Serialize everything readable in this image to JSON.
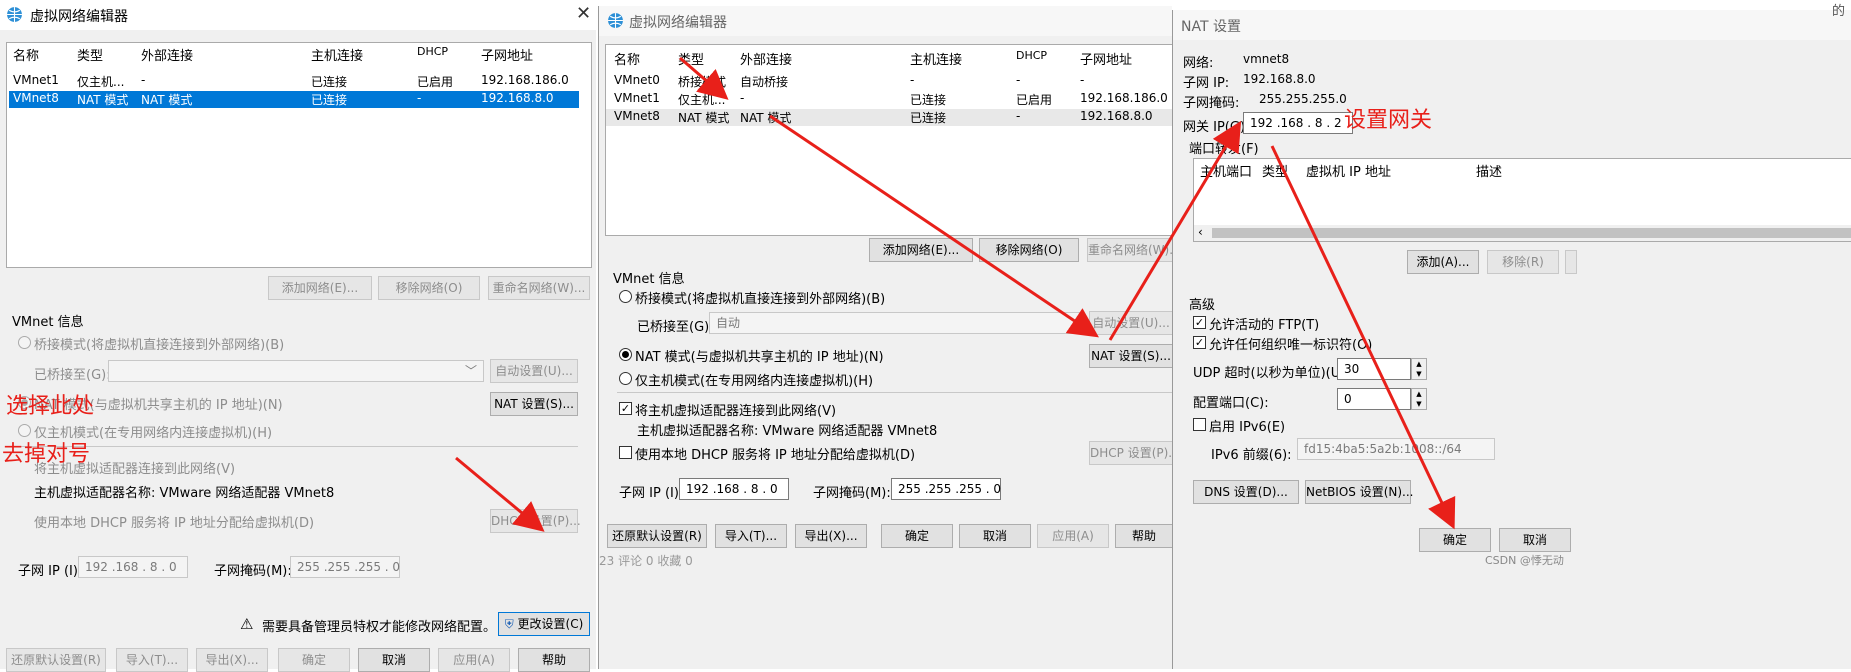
{
  "left_dialog": {
    "title": "虚拟网络编辑器",
    "columns": [
      "名称",
      "类型",
      "外部连接",
      "主机连接",
      "DHCP",
      "子网地址"
    ],
    "rows": [
      [
        "VMnet1",
        "仅主机...",
        "-",
        "已连接",
        "已启用",
        "192.168.186.0"
      ],
      [
        "VMnet8",
        "NAT 模式",
        "NAT 模式",
        "已连接",
        "-",
        "192.168.8.0"
      ]
    ],
    "buttons": {
      "add": "添加网络(E)...",
      "remove": "移除网络(O)",
      "rename": "重命名网络(W)..."
    },
    "vmnet_info": "VMnet 信息",
    "bridge_mode": "桥接模式(将虚拟机直接连接到外部网络)(B)",
    "bridged_to": "已桥接至(G):",
    "auto_settings": "自动设置(U)...",
    "nat_mode": "NAT 模式(与虚拟机共享主机的 IP 地址)(N)",
    "nat_settings": "NAT 设置(S)...",
    "host_only": "仅主机模式(在专用网络内连接虚拟机)(H)",
    "connect_adapter": "将主机虚拟适配器连接到此网络(V)",
    "adapter_name": "主机虚拟适配器名称: VMware 网络适配器 VMnet8",
    "use_dhcp": "使用本地 DHCP 服务将 IP 地址分配给虚拟机(D)",
    "dhcp_settings": "DHCP 设置(P)...",
    "subnet_ip_label": "子网 IP (I):",
    "subnet_ip": "192 .168 . 8  . 0",
    "mask_label": "子网掩码(M):",
    "mask": "255 .255 .255 . 0",
    "warn": "需要具备管理员特权才能修改网络配置。",
    "change_settings": "更改设置(C)",
    "bottom": {
      "restore": "还原默认设置(R)",
      "import": "导入(T)...",
      "export": "导出(X)...",
      "ok": "确定",
      "cancel": "取消",
      "apply": "应用(A)",
      "help": "帮助"
    }
  },
  "mid_dialog": {
    "title": "虚拟网络编辑器",
    "columns": [
      "名称",
      "类型",
      "外部连接",
      "主机连接",
      "DHCP",
      "子网地址"
    ],
    "rows": [
      [
        "VMnet0",
        "桥接模式",
        "自动桥接",
        "-",
        "-",
        "-"
      ],
      [
        "VMnet1",
        "仅主机...",
        "-",
        "已连接",
        "已启用",
        "192.168.186.0"
      ],
      [
        "VMnet8",
        "NAT 模式",
        "NAT 模式",
        "已连接",
        "-",
        "192.168.8.0"
      ]
    ],
    "buttons": {
      "add": "添加网络(E)...",
      "remove": "移除网络(O)",
      "rename": "重命名网络(W)..."
    },
    "vmnet_info": "VMnet 信息",
    "bridge_mode": "桥接模式(将虚拟机直接连接到外部网络)(B)",
    "bridged_to": "已桥接至(G):",
    "bridged_value": "自动",
    "auto_settings": "自动设置(U)...",
    "nat_mode": "NAT 模式(与虚拟机共享主机的 IP 地址)(N)",
    "nat_settings": "NAT 设置(S)...",
    "host_only": "仅主机模式(在专用网络内连接虚拟机)(H)",
    "connect_adapter": "将主机虚拟适配器连接到此网络(V)",
    "adapter_name": "主机虚拟适配器名称: VMware 网络适配器 VMnet8",
    "use_dhcp": "使用本地 DHCP 服务将 IP 地址分配给虚拟机(D)",
    "dhcp_settings": "DHCP 设置(P)...",
    "subnet_ip_label": "子网 IP (I):",
    "subnet_ip": "192 .168 . 8  . 0",
    "mask_label": "子网掩码(M):",
    "mask": "255 .255 .255 . 0",
    "bottom": {
      "restore": "还原默认设置(R)",
      "import": "导入(T)...",
      "export": "导出(X)...",
      "ok": "确定",
      "cancel": "取消",
      "apply": "应用(A)",
      "help": "帮助"
    }
  },
  "nat_dialog": {
    "title": "NAT 设置",
    "network_label": "网络:",
    "network": "vmnet8",
    "subnet_ip_label": "子网 IP:",
    "subnet_ip": "192.168.8.0",
    "mask_label": "子网掩码:",
    "mask": "255.255.255.0",
    "gateway_label": "网关 IP(G):",
    "gateway": "192 .168 . 8  . 2",
    "port_forward": "端口转发(F)",
    "pf_columns": [
      "主机端口",
      "类型",
      "虚拟机 IP 地址",
      "描述"
    ],
    "add": "添加(A)...",
    "remove": "移除(R)",
    "advanced": "高级",
    "allow_ftp": "允许活动的 FTP(T)",
    "allow_uid": "允许任何组织唯一标识符(O)",
    "udp_label": "UDP 超时(以秒为单位)(U):",
    "udp": "30",
    "config_port_label": "配置端口(C):",
    "config_port": "0",
    "ipv6_enable": "启用 IPv6(E)",
    "ipv6_prefix_label": "IPv6 前缀(6):",
    "ipv6_prefix": "fd15:4ba5:5a2b:1008::/64",
    "dns": "DNS 设置(D)...",
    "netbios": "NetBIOS 设置(N)...",
    "ok": "确定",
    "cancel": "取消"
  },
  "annotations": {
    "select_here": "选择此处",
    "uncheck": "去掉对号",
    "set_gateway": "设置网关"
  },
  "background": {
    "left_text": "23   评论 0    收藏 0",
    "watermark": "CSDN @悸无动",
    "right_text": "的"
  },
  "colors": {
    "selection": "#0078d7",
    "annotation": "#e8201a"
  }
}
